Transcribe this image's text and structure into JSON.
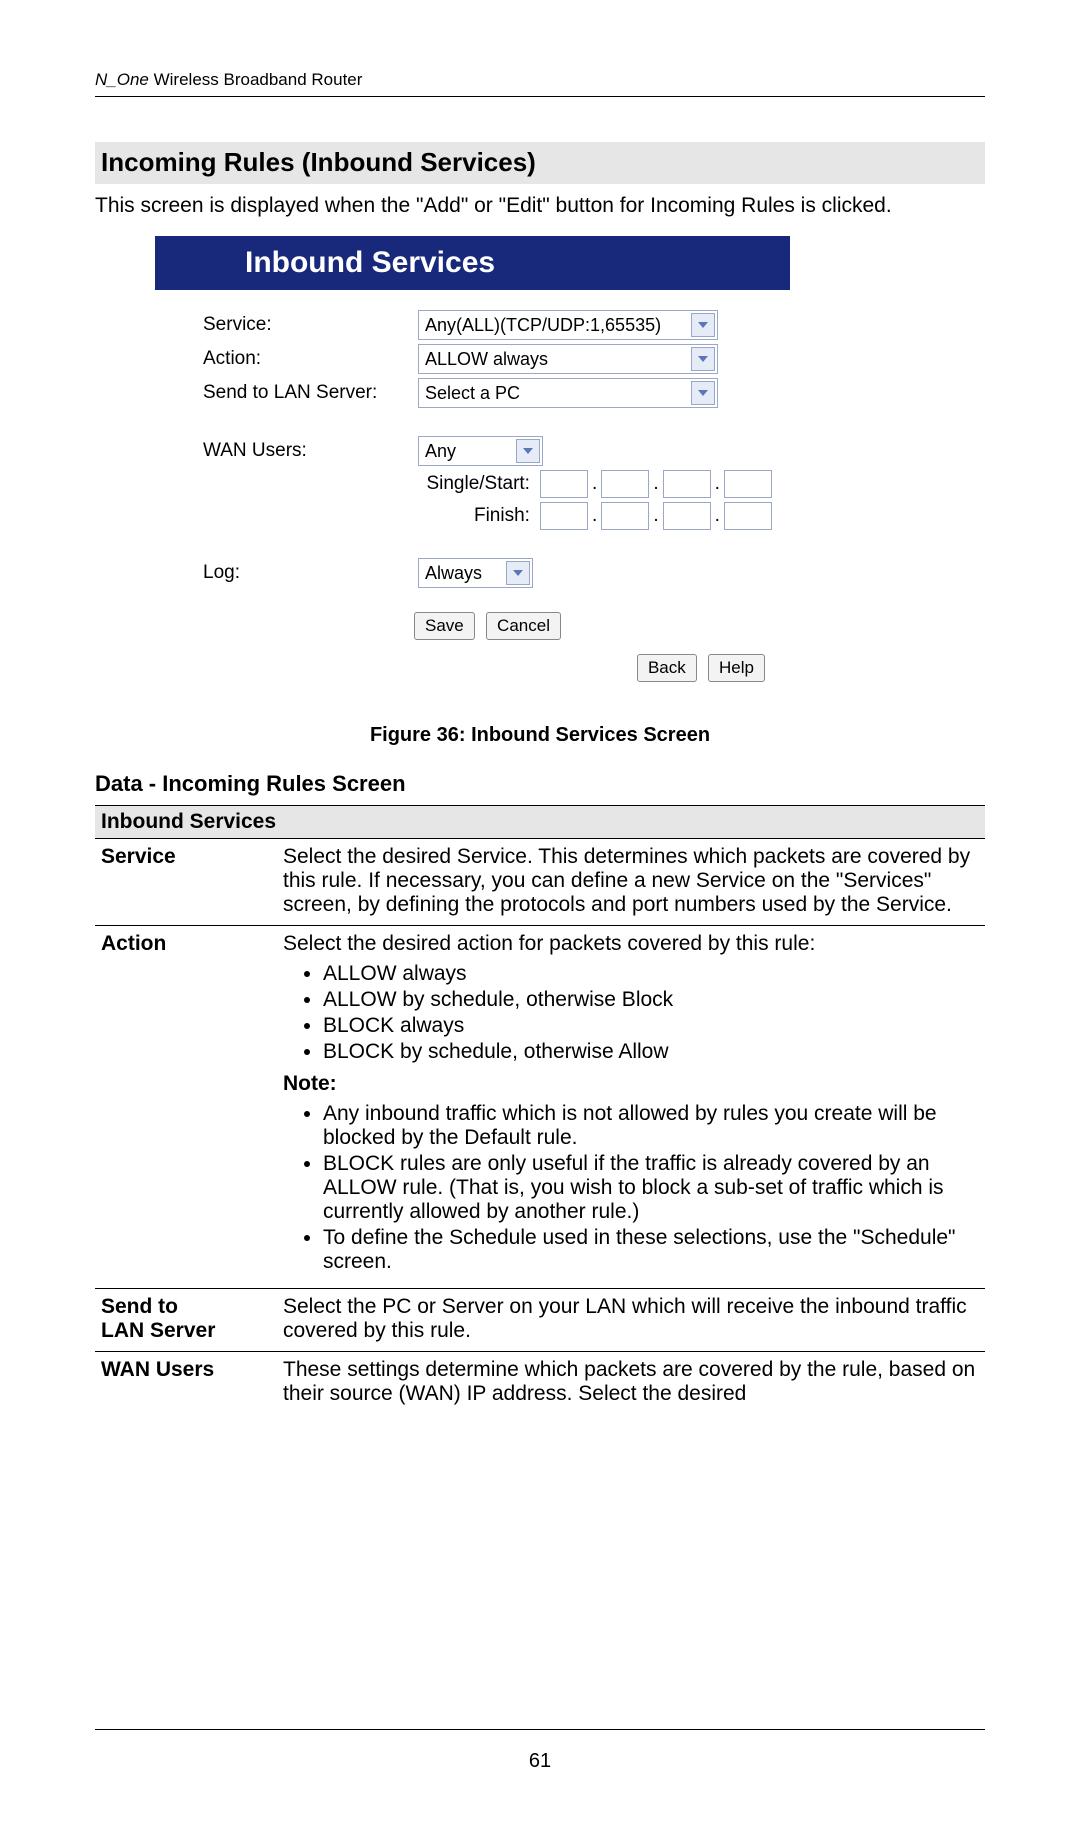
{
  "header": {
    "product_italic": "N_One",
    "product_rest": " Wireless Broadband Router"
  },
  "section_title": "Incoming Rules (Inbound Services)",
  "intro": "This screen is displayed when the \"Add\" or \"Edit\" button for Incoming Rules is clicked.",
  "screenshot": {
    "title": "Inbound Services",
    "labels": {
      "service": "Service:",
      "action": "Action:",
      "send_to": "Send to LAN Server:",
      "wan_users": "WAN Users:",
      "single_start": "Single/Start:",
      "finish": "Finish:",
      "log": "Log:"
    },
    "values": {
      "service": "Any(ALL)(TCP/UDP:1,65535)",
      "action": "ALLOW always",
      "send_to": "Select a PC",
      "wan_users": "Any",
      "log": "Always"
    },
    "buttons": {
      "save": "Save",
      "cancel": "Cancel",
      "back": "Back",
      "help": "Help"
    }
  },
  "caption": "Figure 36: Inbound Services Screen",
  "data_section_title": "Data - Incoming Rules Screen",
  "table": {
    "header": "Inbound Services",
    "rows": {
      "service": {
        "label": "Service",
        "text": "Select the desired Service. This determines which packets are covered by this rule. If necessary, you can define a new Service on the \"Services\" screen, by defining the protocols and port numbers used by the Service."
      },
      "action": {
        "label": "Action",
        "intro": "Select the desired action for packets covered by this rule:",
        "opts": [
          "ALLOW always",
          "ALLOW by schedule, otherwise Block",
          "BLOCK always",
          "BLOCK by schedule, otherwise Allow"
        ],
        "note_label": "Note:",
        "notes": [
          "Any inbound traffic which is not allowed by rules you create will be blocked by the Default rule.",
          "BLOCK rules are only useful if the traffic is already covered by an ALLOW rule. (That is, you wish to block a sub-set of traffic which is currently allowed by another rule.)",
          "To define the Schedule used in these selections, use the \"Schedule\" screen."
        ]
      },
      "send_to": {
        "label1": "Send to",
        "label2": "LAN Server",
        "text": "Select the PC or Server on your LAN which will receive the inbound traffic covered by this rule."
      },
      "wan_users": {
        "label": "WAN Users",
        "text": "These settings determine which packets are covered by the rule, based on their source (WAN) IP address. Select the desired"
      }
    }
  },
  "page_number": "61"
}
